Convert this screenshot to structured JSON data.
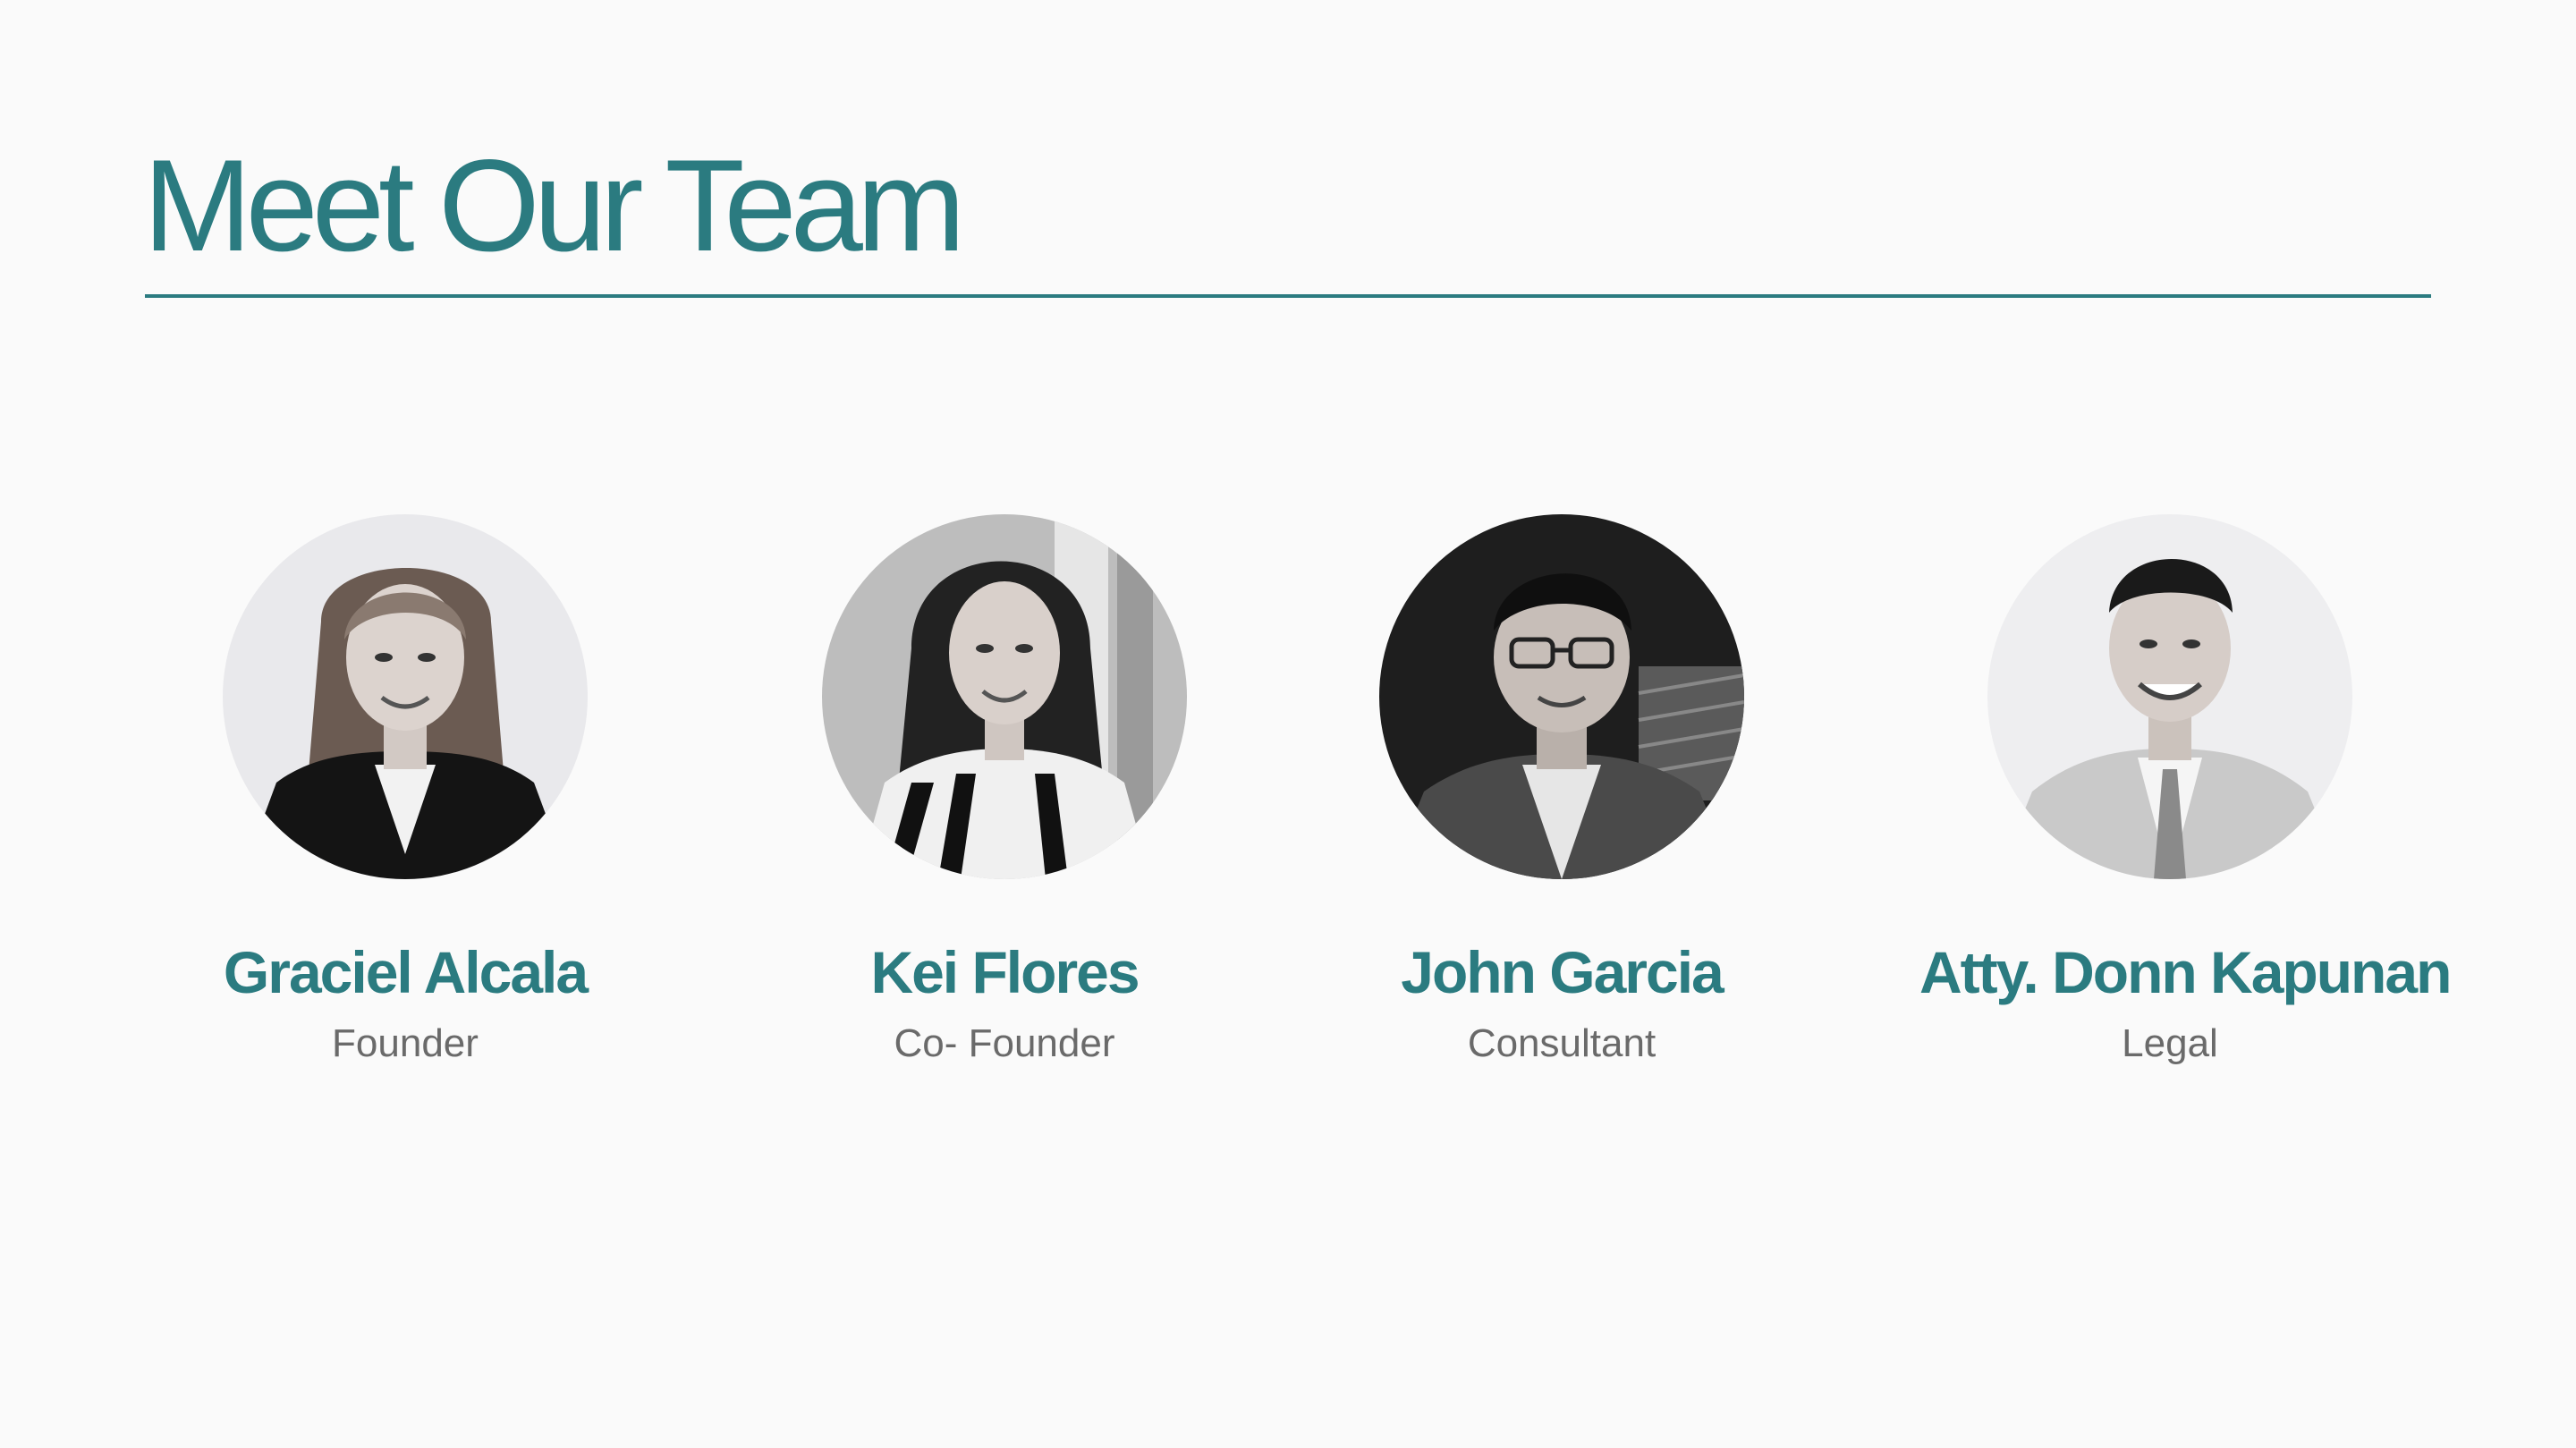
{
  "slide": {
    "title": "Meet Our Team"
  },
  "team": {
    "members": [
      {
        "name": "Graciel Alcala",
        "role": "Founder"
      },
      {
        "name": "Kei Flores",
        "role": "Co- Founder"
      },
      {
        "name": "John Garcia",
        "role": "Consultant"
      },
      {
        "name": "Atty. Donn Kapunan",
        "role": "Legal"
      }
    ]
  },
  "colors": {
    "accent": "#2b7b80",
    "background": "#fafafa",
    "role_text": "#6a6a6a"
  }
}
